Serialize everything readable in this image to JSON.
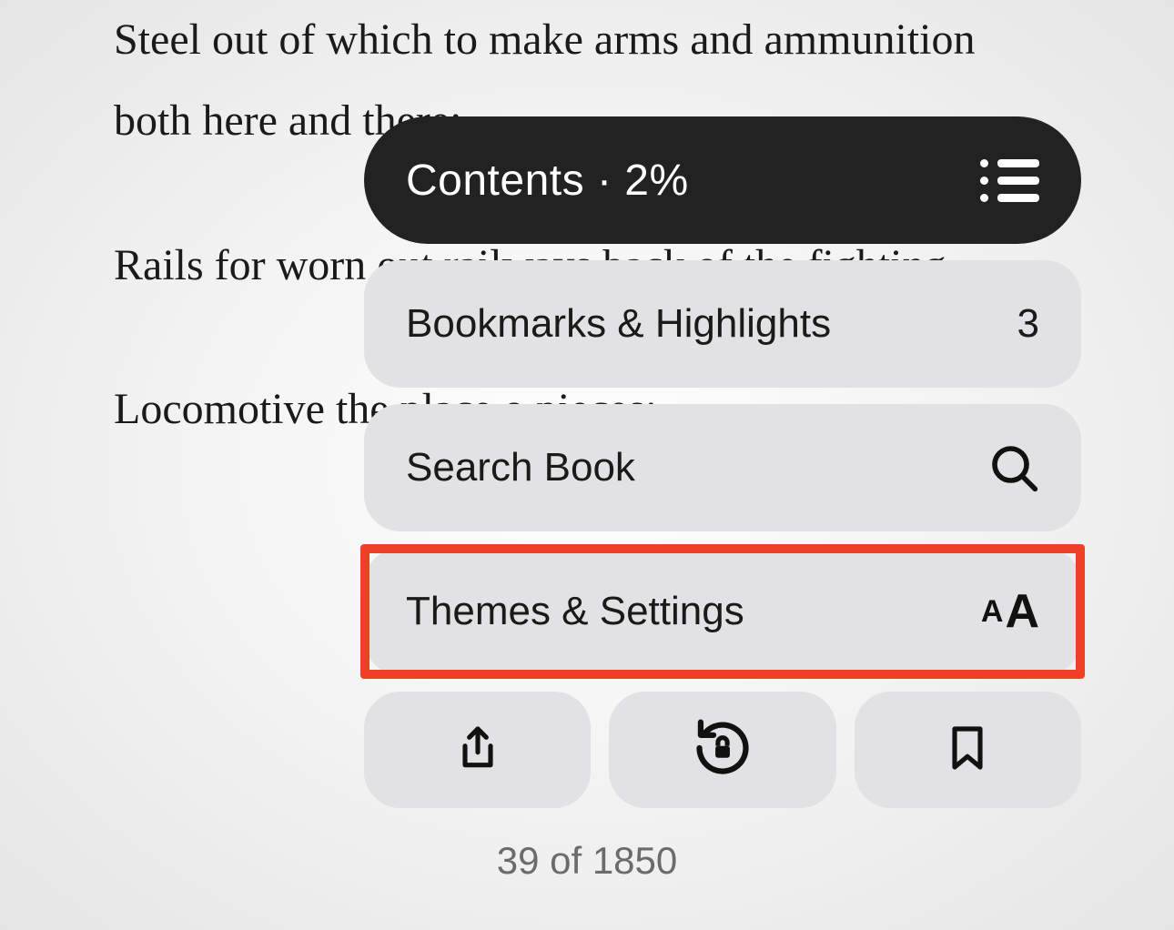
{
  "page": {
    "paragraph1": "Steel out of which to make arms and ammunition both here and there;",
    "paragraph2": "Rails for worn out railways back of the fighting",
    "paragraph3": "Locomotive the place o pieces;"
  },
  "popover": {
    "contents_label": "Contents · 2%",
    "bookmarks_label": "Bookmarks & Highlights",
    "bookmarks_count": "3",
    "search_label": "Search Book",
    "themes_label": "Themes & Settings"
  },
  "footer": {
    "page_indicator": "39 of 1850"
  },
  "icons": {
    "contents": "list-icon",
    "search": "search-icon",
    "text_size": "text-size-icon",
    "share": "share-icon",
    "rotation_lock": "rotation-lock-icon",
    "bookmark": "bookmark-icon"
  }
}
